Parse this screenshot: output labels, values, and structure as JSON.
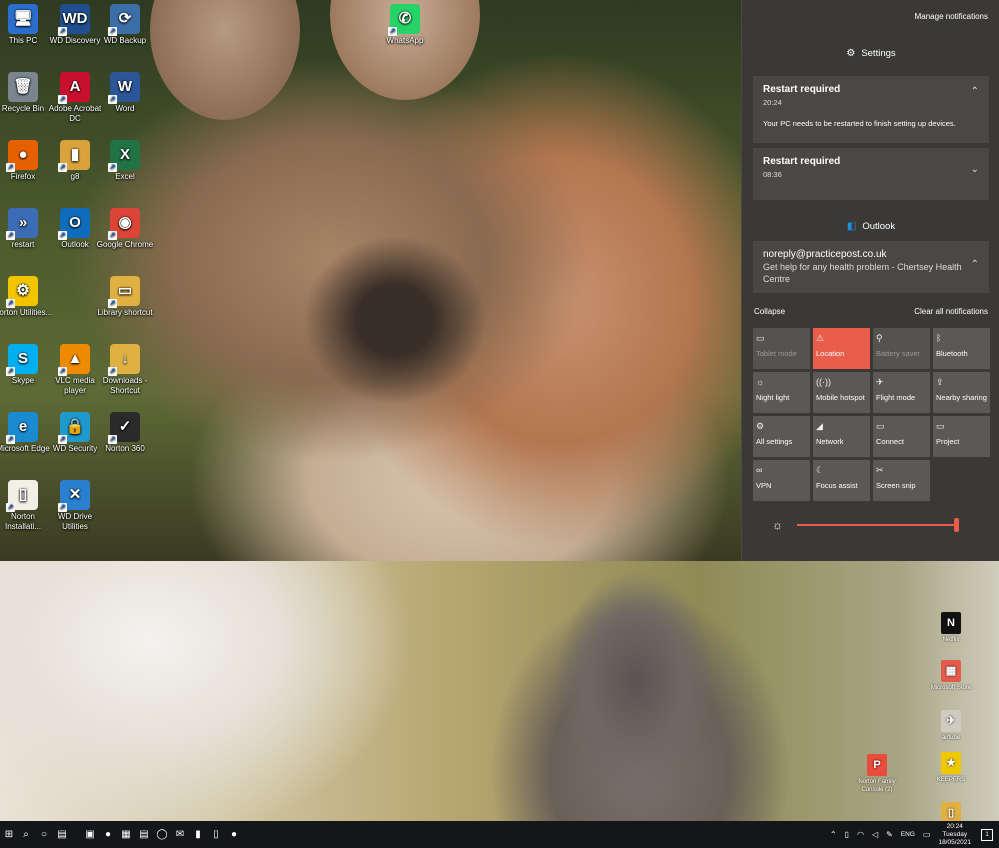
{
  "desktop_top_icons": [
    {
      "label": "This PC",
      "glyph": "🖥",
      "bg": "#2a6fcf"
    },
    {
      "label": "WD Discovery",
      "glyph": "WD",
      "bg": "#1f4f8f"
    },
    {
      "label": "WD Backup",
      "glyph": "⟳",
      "bg": "#3c6ea8"
    },
    {
      "label": "WhatsApp",
      "glyph": "✆",
      "bg": "#25d366"
    },
    {
      "label": "Recycle Bin",
      "glyph": "🗑",
      "bg": "#7a8590"
    },
    {
      "label": "Adobe Acrobat DC",
      "glyph": "A",
      "bg": "#c8102e"
    },
    {
      "label": "Word",
      "glyph": "W",
      "bg": "#2b579a"
    },
    {
      "label": "Firefox",
      "glyph": "●",
      "bg": "#e66000"
    },
    {
      "label": "g8",
      "glyph": "▮",
      "bg": "#d9a23a"
    },
    {
      "label": "Excel",
      "glyph": "X",
      "bg": "#217346"
    },
    {
      "label": "restart",
      "glyph": "»",
      "bg": "#3b6cb5"
    },
    {
      "label": "Outlook",
      "glyph": "O",
      "bg": "#0f6cbd"
    },
    {
      "label": "Google Chrome",
      "glyph": "◉",
      "bg": "#db4437"
    },
    {
      "label": "Norton Utilities...",
      "glyph": "⚙",
      "bg": "#f2c500"
    },
    {
      "label": "Library shortcut",
      "glyph": "▭",
      "bg": "#e0b042"
    },
    {
      "label": "Skype",
      "glyph": "S",
      "bg": "#00aff0"
    },
    {
      "label": "VLC media player",
      "glyph": "▲",
      "bg": "#f08a00"
    },
    {
      "label": "Downloads - Shortcut",
      "glyph": "↓",
      "bg": "#e0b042"
    },
    {
      "label": "Microsoft Edge",
      "glyph": "e",
      "bg": "#1b8bd1"
    },
    {
      "label": "WD Security",
      "glyph": "🔒",
      "bg": "#1f9acb"
    },
    {
      "label": "Norton 360",
      "glyph": "✓",
      "bg": "#2a2a2a"
    },
    {
      "label": "Norton Installati...",
      "glyph": "▯",
      "bg": "#f2efe6"
    },
    {
      "label": "WD Drive Utilities",
      "glyph": "✕",
      "bg": "#2b7fd1"
    }
  ],
  "desktop_bottom_icons": [
    {
      "label": "Netflix",
      "glyph": "N",
      "bg": "#111"
    },
    {
      "label": "Microsoft Store",
      "glyph": "▦",
      "bg": "#e35b4d"
    },
    {
      "label": "airtube",
      "glyph": "✈",
      "bg": "#cfcbc0"
    },
    {
      "label": "KEEPERS",
      "glyph": "★",
      "bg": "#f0c800"
    },
    {
      "label": "Norton Family Console (2)",
      "glyph": "P",
      "bg": "#e94b3c"
    },
    {
      "label": "",
      "glyph": "▯",
      "bg": "#e0b042"
    }
  ],
  "action_center": {
    "manage_label": "Manage notifications",
    "settings_group": "Settings",
    "card1": {
      "title": "Restart required",
      "time": "20:24",
      "body": "Your PC needs to be restarted to finish setting up devices."
    },
    "card2": {
      "title": "Restart required",
      "time": "08:36"
    },
    "outlook_group": "Outlook",
    "card3": {
      "title": "noreply@practicepost.co.uk",
      "body": "Get help for any health problem - Chertsey Health Centre"
    },
    "collapse_label": "Collapse",
    "clear_label": "Clear all notifications",
    "tiles": [
      {
        "label": "Tablet mode",
        "glyph": "▭",
        "state": "off"
      },
      {
        "label": "Location",
        "glyph": "⚠",
        "state": "on"
      },
      {
        "label": "Battery saver",
        "glyph": "⚲",
        "state": "off"
      },
      {
        "label": "Bluetooth",
        "glyph": "ᛒ",
        "state": "normal"
      },
      {
        "label": "Night light",
        "glyph": "☼",
        "state": "normal"
      },
      {
        "label": "Mobile hotspot",
        "glyph": "((·))",
        "state": "normal"
      },
      {
        "label": "Flight mode",
        "glyph": "✈",
        "state": "normal"
      },
      {
        "label": "Nearby sharing",
        "glyph": "⇪",
        "state": "normal"
      },
      {
        "label": "All settings",
        "glyph": "⚙",
        "state": "normal"
      },
      {
        "label": "Network",
        "glyph": "◢",
        "state": "normal"
      },
      {
        "label": "Connect",
        "glyph": "▭",
        "state": "normal"
      },
      {
        "label": "Project",
        "glyph": "▭",
        "state": "normal"
      },
      {
        "label": "VPN",
        "glyph": "∞",
        "state": "normal"
      },
      {
        "label": "Focus assist",
        "glyph": "☾",
        "state": "normal"
      },
      {
        "label": "Screen snip",
        "glyph": "✂",
        "state": "normal"
      }
    ],
    "brightness": 1.0
  },
  "taskbar": {
    "buttons": [
      "⊞",
      "⌕",
      "○",
      "▤",
      "▣",
      "●",
      "▦",
      "▤",
      "◯",
      "✉",
      "▮",
      "▯",
      "●"
    ],
    "tray_lang": "ENG",
    "time": "20:24",
    "day": "Tuesday",
    "date": "18/05/2021"
  },
  "colors": {
    "accent": "#e85e4a",
    "panel": "#3b3937",
    "card": "#4a4745"
  }
}
